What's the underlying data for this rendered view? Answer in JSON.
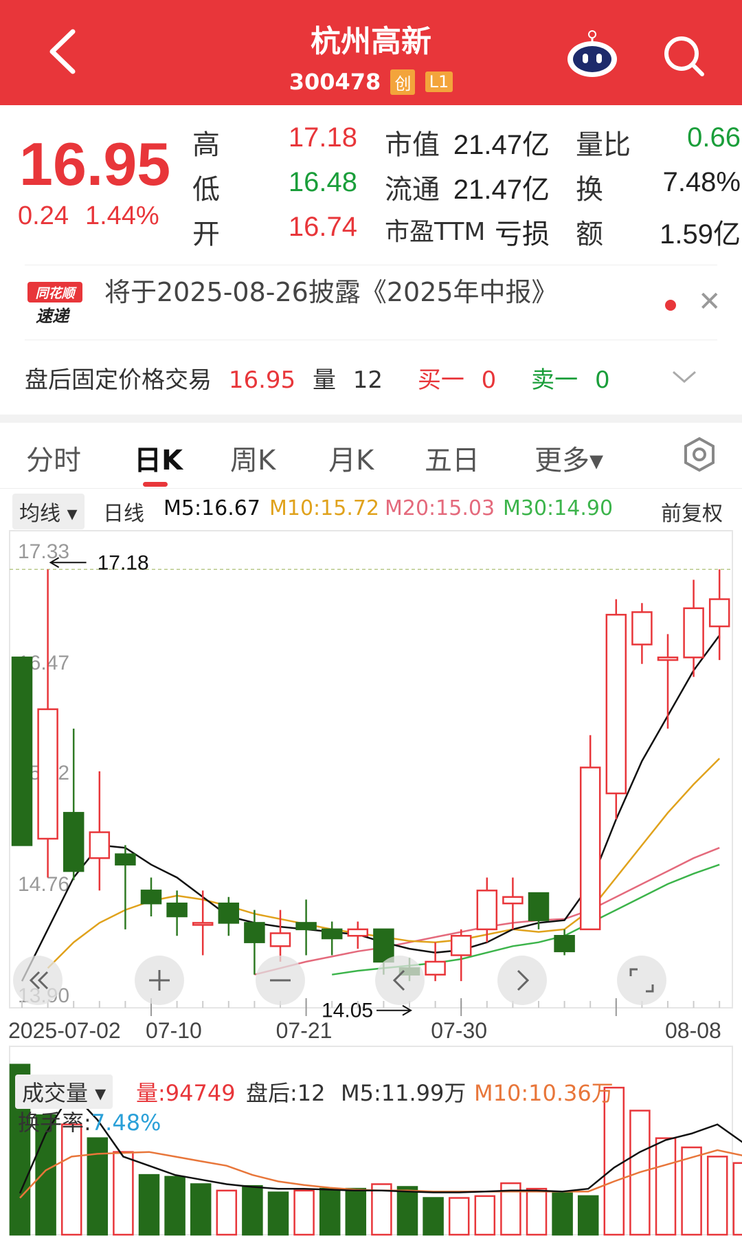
{
  "header": {
    "title": "杭州高新",
    "code": "300478",
    "badges": [
      "创",
      "L1"
    ]
  },
  "quote": {
    "price": "16.95",
    "change": "0.24",
    "change_pct": "1.44%",
    "rows": [
      {
        "l1": "高",
        "v1": "17.18",
        "l2": "市值",
        "v2": "21.47亿",
        "l3": "量比",
        "v3": "0.66"
      },
      {
        "l1": "低",
        "v1": "16.48",
        "l2": "流通",
        "v2": "21.47亿",
        "l3": "换",
        "v3": "7.48%"
      },
      {
        "l1": "开",
        "v1": "16.74",
        "l2": "市盈TTM",
        "v2": "亏损",
        "l3": "额",
        "v3": "1.59亿"
      }
    ]
  },
  "notice": {
    "logo_line1": "同花顺",
    "logo_line2": "速递",
    "text": "将于2025-08-26披露《2025年中报》"
  },
  "after_hours": {
    "label": "盘后固定价格交易",
    "price": "16.95",
    "vol_label": "量",
    "vol": "12",
    "buy": "买一",
    "buy_val": "0",
    "sell": "卖一",
    "sell_val": "0"
  },
  "tabs": [
    "分时",
    "日K",
    "周K",
    "月K",
    "五日",
    "更多▾"
  ],
  "ma_bar": {
    "selector": "均线 ▾",
    "period": "日线",
    "m5": "M5:16.67",
    "m10": "M10:15.72",
    "m20": "M20:15.03",
    "m30": "M30:14.90",
    "adjust": "前复权"
  },
  "colors": {
    "up": "#e8363a",
    "down": "#246b1a",
    "m5": "#111111",
    "m10": "#e0a21c",
    "m20": "#e46a7c",
    "m30": "#3cb44b",
    "vol_m10": "#e8763a"
  },
  "chart_data": {
    "type": "candlestick",
    "y_ticks": [
      "17.33",
      "16.47",
      "15.62",
      "14.76",
      "13.90"
    ],
    "ylim": [
      13.9,
      17.33
    ],
    "high_marker": "17.18",
    "low_marker": "14.05",
    "dashed_level": 17.18,
    "x_ticks": [
      "2025-07-02",
      "07-10",
      "07-21",
      "07-30",
      "08-08"
    ],
    "candles": [
      {
        "o": 16.5,
        "c": 15.05,
        "h": 16.5,
        "l": 15.05
      },
      {
        "o": 15.1,
        "c": 16.1,
        "h": 17.18,
        "l": 14.8
      },
      {
        "o": 15.3,
        "c": 14.85,
        "h": 15.95,
        "l": 14.78
      },
      {
        "o": 14.95,
        "c": 15.15,
        "h": 15.62,
        "l": 14.7
      },
      {
        "o": 14.98,
        "c": 14.9,
        "h": 15.05,
        "l": 14.4
      },
      {
        "o": 14.7,
        "c": 14.6,
        "h": 14.8,
        "l": 14.5
      },
      {
        "o": 14.6,
        "c": 14.5,
        "h": 14.7,
        "l": 14.35
      },
      {
        "o": 14.45,
        "c": 14.45,
        "h": 14.7,
        "l": 14.2
      },
      {
        "o": 14.6,
        "c": 14.45,
        "h": 14.65,
        "l": 14.35
      },
      {
        "o": 14.45,
        "c": 14.3,
        "h": 14.55,
        "l": 14.05
      },
      {
        "o": 14.27,
        "c": 14.37,
        "h": 14.55,
        "l": 14.15
      },
      {
        "o": 14.45,
        "c": 14.4,
        "h": 14.63,
        "l": 14.2
      },
      {
        "o": 14.4,
        "c": 14.33,
        "h": 14.46,
        "l": 14.2
      },
      {
        "o": 14.35,
        "c": 14.4,
        "h": 14.46,
        "l": 14.25
      },
      {
        "o": 14.4,
        "c": 14.15,
        "h": 14.4,
        "l": 14.05
      },
      {
        "o": 14.1,
        "c": 14.05,
        "h": 14.18,
        "l": 14.0
      },
      {
        "o": 14.05,
        "c": 14.15,
        "h": 14.3,
        "l": 14.0
      },
      {
        "o": 14.2,
        "c": 14.35,
        "h": 14.4,
        "l": 14.0
      },
      {
        "o": 14.4,
        "c": 14.7,
        "h": 14.8,
        "l": 14.3
      },
      {
        "o": 14.6,
        "c": 14.65,
        "h": 14.8,
        "l": 14.4
      },
      {
        "o": 14.68,
        "c": 14.47,
        "h": 14.68,
        "l": 14.4
      },
      {
        "o": 14.35,
        "c": 14.23,
        "h": 14.4,
        "l": 14.2
      },
      {
        "o": 14.4,
        "c": 15.65,
        "h": 15.9,
        "l": 14.4
      },
      {
        "o": 15.45,
        "c": 16.83,
        "h": 16.95,
        "l": 15.25
      },
      {
        "o": 16.6,
        "c": 16.85,
        "h": 16.92,
        "l": 16.45
      },
      {
        "o": 16.48,
        "c": 16.5,
        "h": 16.68,
        "l": 15.95
      },
      {
        "o": 16.5,
        "c": 16.88,
        "h": 17.1,
        "l": 16.35
      },
      {
        "o": 16.74,
        "c": 16.95,
        "h": 17.18,
        "l": 16.48
      }
    ],
    "ma5": [
      14.0,
      14.4,
      14.8,
      15.05,
      15.03,
      14.9,
      14.8,
      14.65,
      14.5,
      14.45,
      14.42,
      14.4,
      14.38,
      14.36,
      14.3,
      14.25,
      14.22,
      14.24,
      14.3,
      14.4,
      14.45,
      14.47,
      14.75,
      15.25,
      15.7,
      16.05,
      16.4,
      16.67
    ],
    "ma10": [
      null,
      14.1,
      14.3,
      14.45,
      14.55,
      14.62,
      14.66,
      14.63,
      14.58,
      14.52,
      14.48,
      14.44,
      14.4,
      14.37,
      14.34,
      14.31,
      14.3,
      14.32,
      14.36,
      14.4,
      14.38,
      14.4,
      14.55,
      14.8,
      15.05,
      15.3,
      15.52,
      15.72
    ],
    "ma20": [
      null,
      null,
      null,
      null,
      null,
      null,
      null,
      null,
      null,
      14.05,
      14.1,
      14.15,
      14.19,
      14.23,
      14.26,
      14.3,
      14.34,
      14.38,
      14.42,
      14.45,
      14.47,
      14.48,
      14.55,
      14.65,
      14.75,
      14.85,
      14.95,
      15.03
    ],
    "ma30": [
      null,
      null,
      null,
      null,
      null,
      null,
      null,
      null,
      null,
      null,
      null,
      null,
      14.05,
      14.08,
      14.1,
      14.12,
      14.14,
      14.17,
      14.22,
      14.27,
      14.3,
      14.35,
      14.45,
      14.55,
      14.65,
      14.75,
      14.83,
      14.9
    ],
    "volume": {
      "header_label": "成交量 ▾",
      "vol": "量:94749",
      "after": "盘后:12",
      "m5": "M5:11.99万",
      "m10": "M10:10.36万",
      "turnover_label": "换手率:",
      "turnover_val": "7.48%",
      "bars": [
        18.5,
        13.0,
        12.0,
        10.5,
        9.0,
        6.5,
        6.3,
        5.5,
        4.8,
        5.3,
        4.6,
        4.8,
        5.0,
        5.0,
        5.5,
        5.2,
        4.0,
        4.0,
        4.2,
        5.6,
        5.0,
        4.5,
        4.2,
        16.0,
        13.5,
        10.5,
        9.5,
        8.5,
        7.8
      ],
      "ma5": [
        4.5,
        11.0,
        15.5,
        12.5,
        8.5,
        7.5,
        6.5,
        6.0,
        5.5,
        5.2,
        5.0,
        5.0,
        4.9,
        4.8,
        4.8,
        4.7,
        4.6,
        4.6,
        4.7,
        4.8,
        4.8,
        4.7,
        5.0,
        7.3,
        9.0,
        10.3,
        11.0,
        12.0,
        10.0
      ],
      "ma10": [
        4.0,
        7.0,
        8.5,
        8.8,
        8.9,
        9.0,
        8.5,
        8.0,
        7.5,
        6.5,
        5.8,
        5.4,
        5.1,
        4.9,
        4.8,
        4.8,
        4.7,
        4.7,
        4.7,
        4.7,
        4.7,
        4.7,
        4.7,
        5.8,
        6.8,
        7.6,
        8.4,
        9.2,
        8.6
      ]
    }
  }
}
